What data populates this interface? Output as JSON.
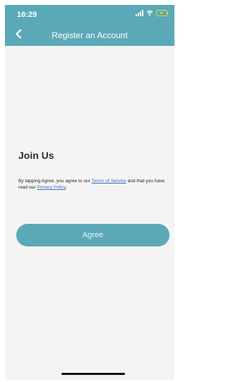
{
  "status_bar": {
    "time": "16:29"
  },
  "nav": {
    "title": "Register an Account",
    "back_icon": "chevron-left-icon"
  },
  "content": {
    "heading": "Join Us",
    "terms_prefix": "By tapping Agree, you agree to our ",
    "terms_link": "Terms of Service",
    "terms_middle": " and that you have read our ",
    "privacy_link": "Privacy Policy",
    "terms_suffix": "."
  },
  "actions": {
    "agree_label": "Agree"
  },
  "colors": {
    "accent": "#5ba9b8",
    "background": "#f4f4f4",
    "link": "#3a6fc4"
  }
}
